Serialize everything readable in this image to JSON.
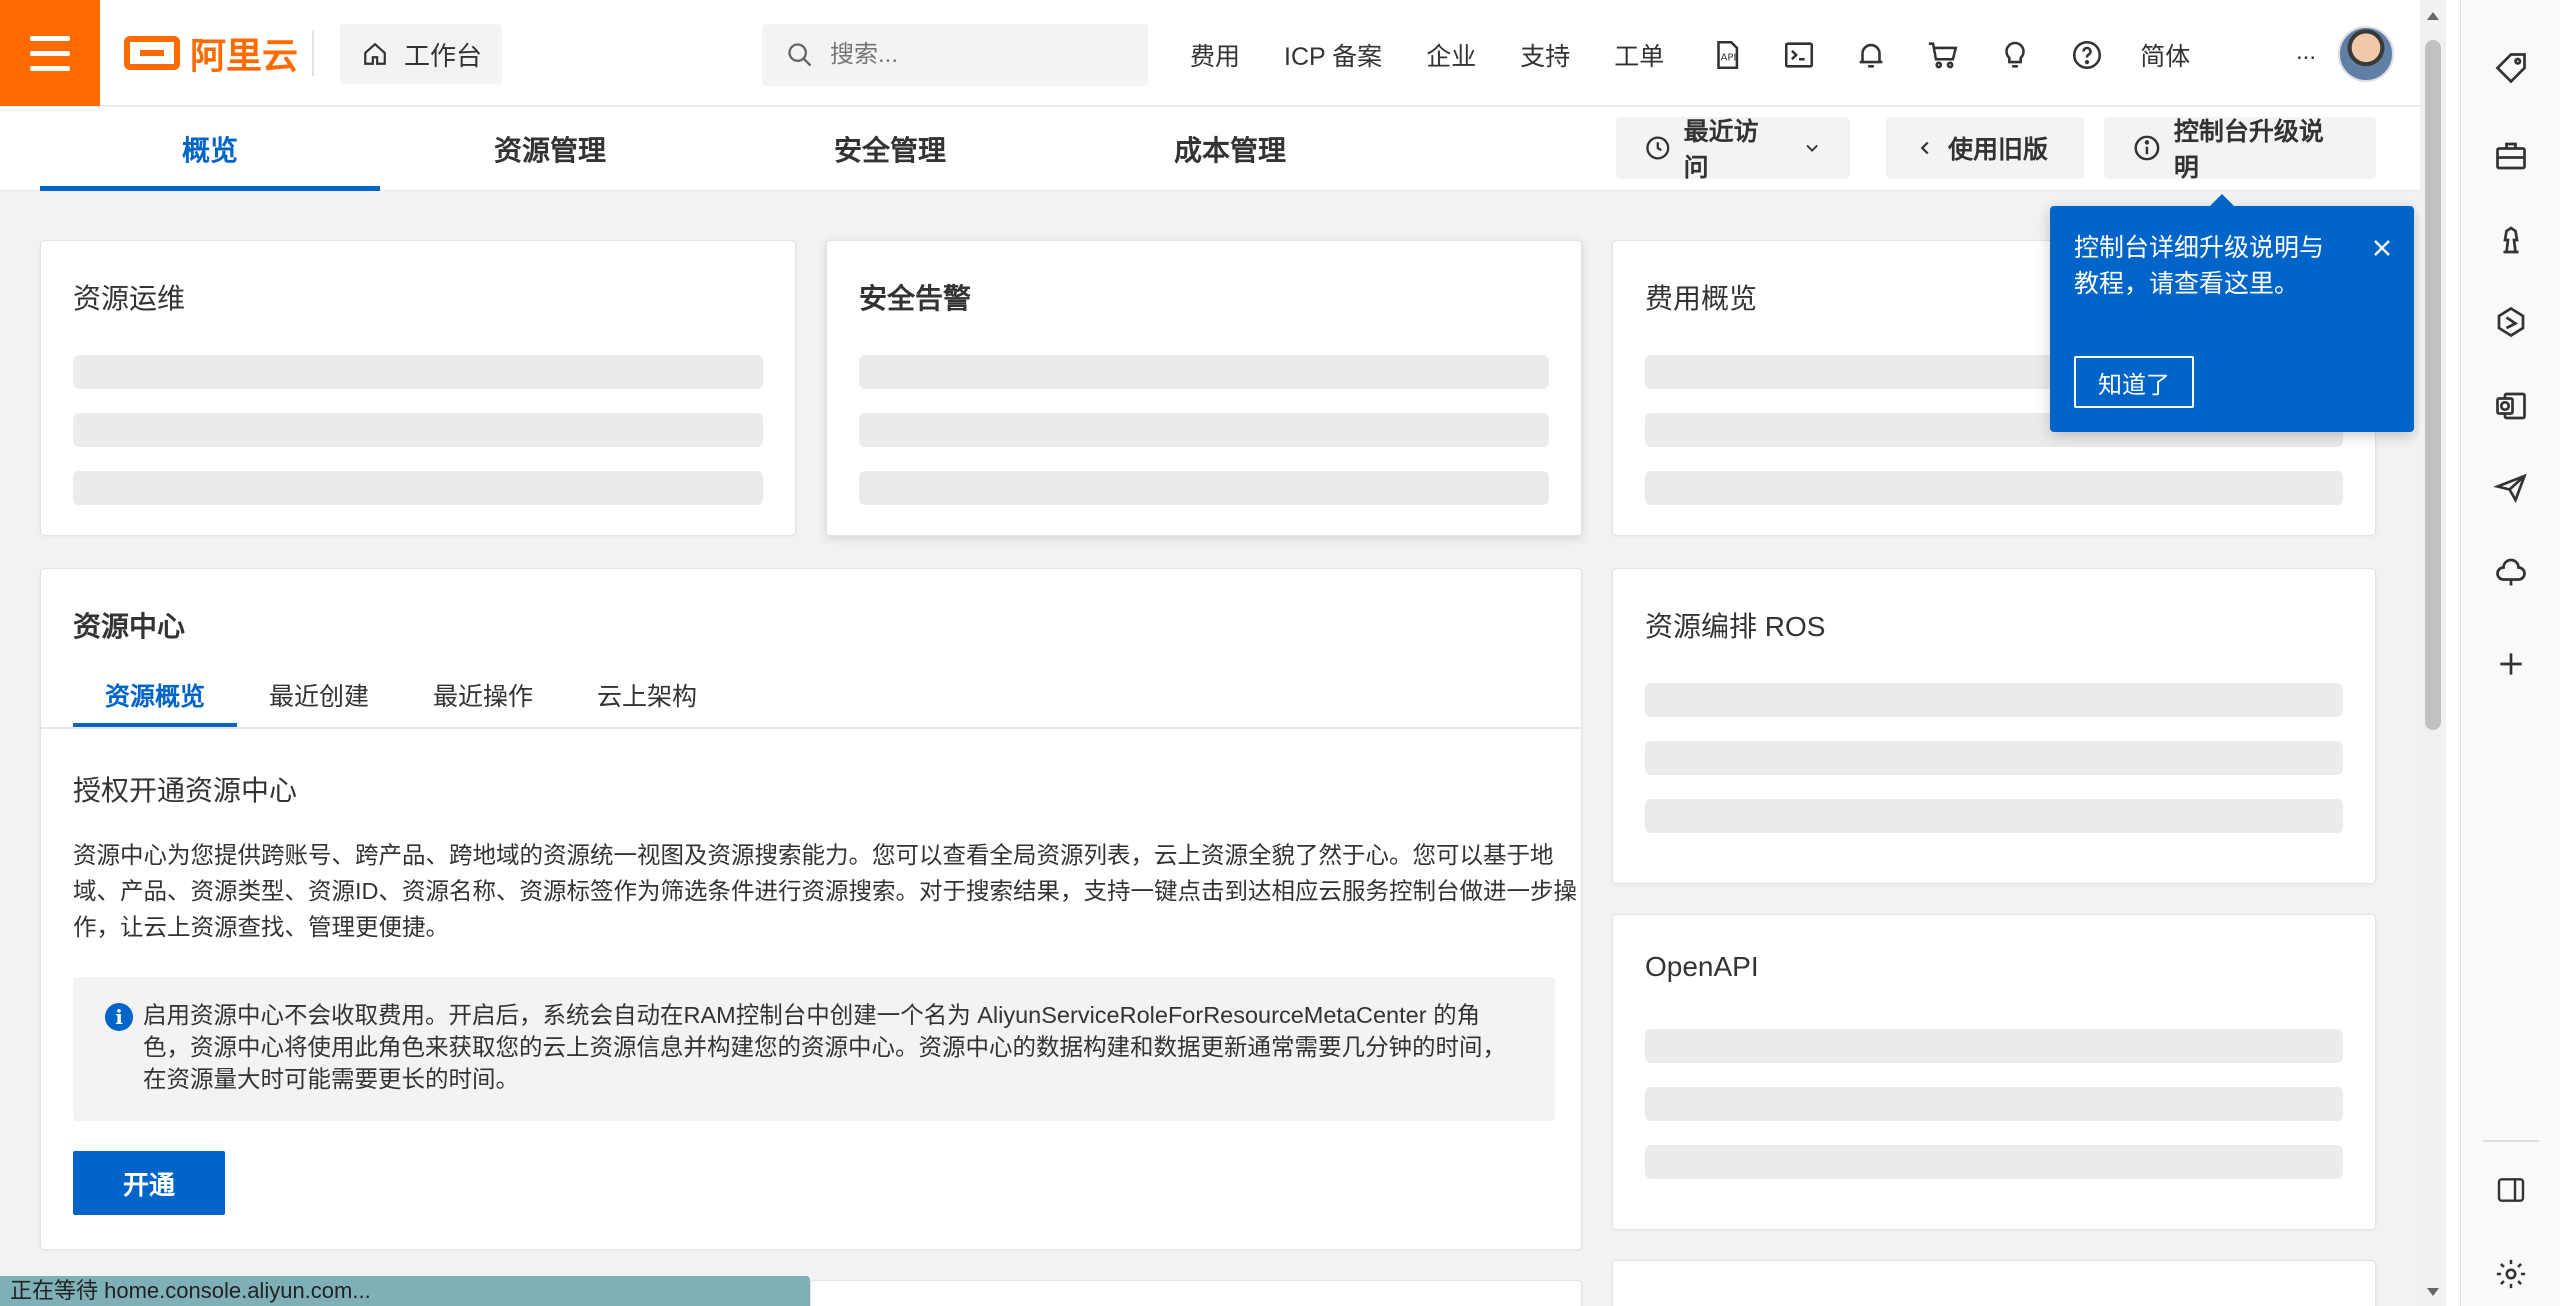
{
  "header": {
    "logo_text": "阿里云",
    "workbench_label": "工作台",
    "search_placeholder": "搜索...",
    "nav_links": [
      "费用",
      "ICP 备案",
      "企业",
      "支持",
      "工单"
    ],
    "nav_icons": [
      "api-icon",
      "terminal-icon",
      "bell-icon",
      "cart-icon",
      "bulb-icon",
      "help-icon"
    ],
    "language": "简体",
    "more": "..."
  },
  "tabs": {
    "items": [
      "概览",
      "资源管理",
      "安全管理",
      "成本管理"
    ],
    "active_index": 0,
    "recent_visit": "最近访问",
    "old_version": "使用旧版",
    "upgrade_info": "控制台升级说明"
  },
  "cards": {
    "ops": {
      "title": "资源运维"
    },
    "security": {
      "title": "安全告警"
    },
    "billing": {
      "title": "费用概览"
    },
    "ros": {
      "title": "资源编排 ROS"
    },
    "openapi": {
      "title": "OpenAPI"
    }
  },
  "resource_center": {
    "title": "资源中心",
    "tabs": [
      "资源概览",
      "最近创建",
      "最近操作",
      "云上架构"
    ],
    "active_tab": 0,
    "subtitle": "授权开通资源中心",
    "description": "资源中心为您提供跨账号、跨产品、跨地域的资源统一视图及资源搜索能力。您可以查看全局资源列表，云上资源全貌了然于心。您可以基于地域、产品、资源类型、资源ID、资源名称、资源标签作为筛选条件进行资源搜索。对于搜索结果，支持一键点击到达相应云服务控制台做进一步操作，让云上资源查找、管理更便捷。",
    "notice": "启用资源中心不会收取费用。开启后，系统会自动在RAM控制台中创建一个名为 AliyunServiceRoleForResourceMetaCenter 的角色，资源中心将使用此角色来获取您的云上资源信息并构建您的资源中心。资源中心的数据构建和数据更新通常需要几分钟的时间，在资源量大时可能需要更长的时间。",
    "open_button": "开通"
  },
  "popover": {
    "text": "控制台详细升级说明与教程，请查看这里。",
    "button": "知道了"
  },
  "status_bar": "正在等待 home.console.aliyun.com...",
  "colors": {
    "brand_orange": "#ff6a00",
    "primary_blue": "#0064c8",
    "skeleton": "#ebebeb",
    "page_bg": "#f1f2f4"
  }
}
